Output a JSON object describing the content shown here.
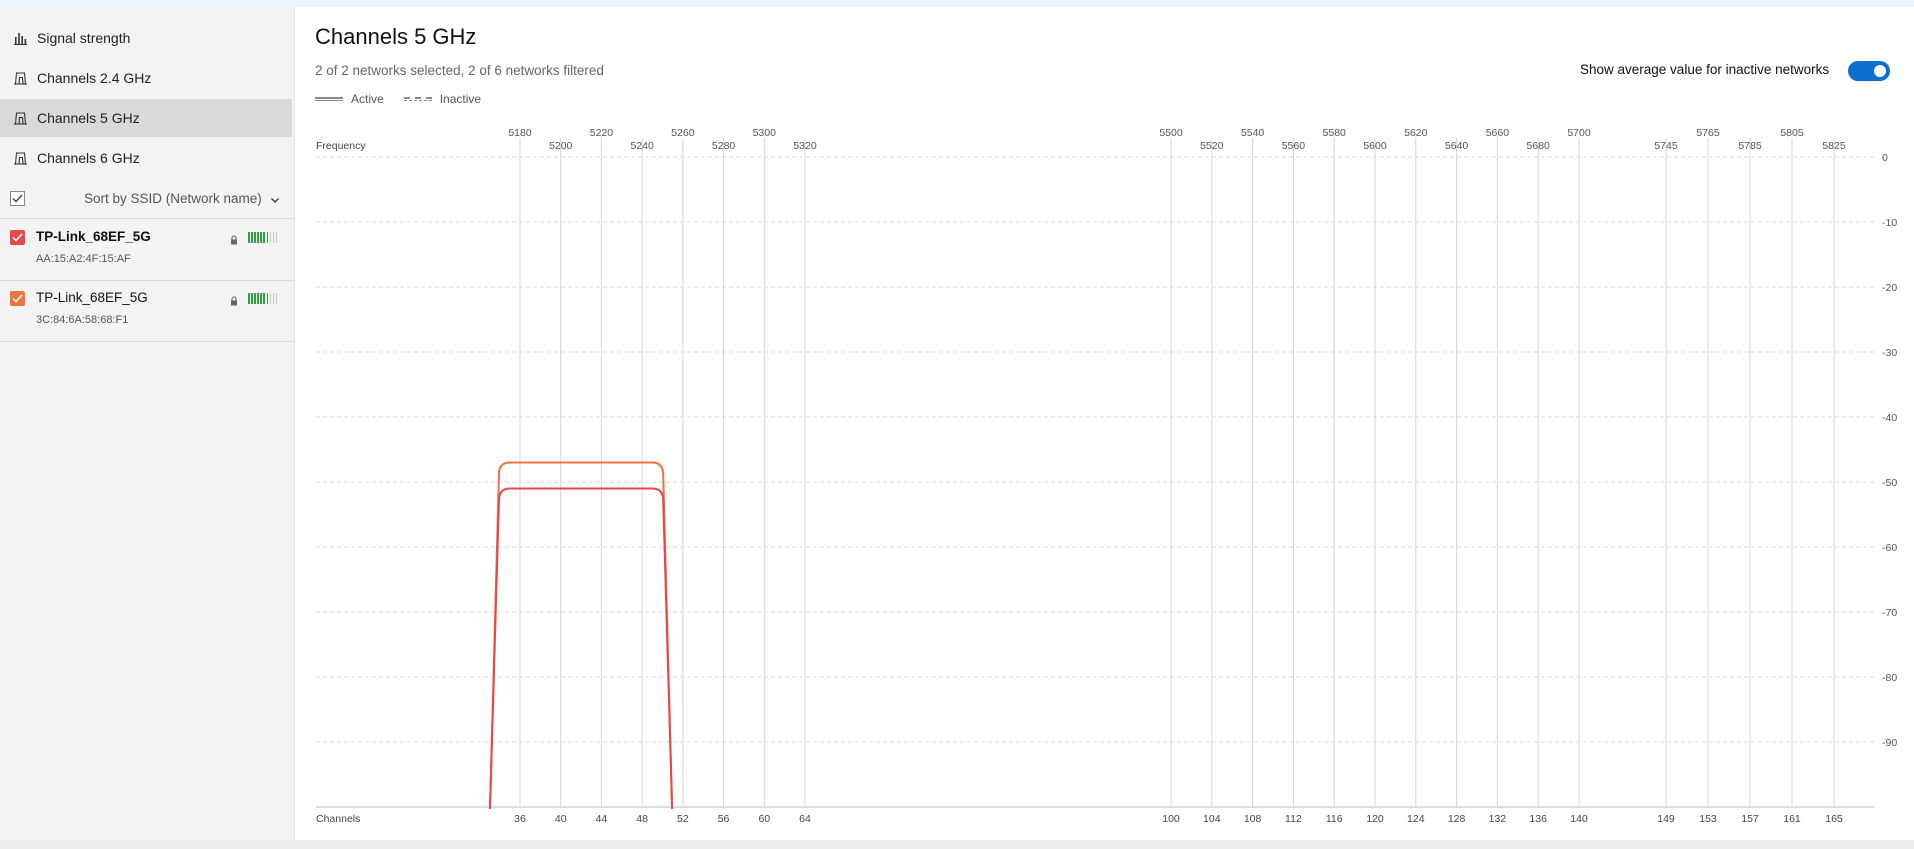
{
  "sidebar": {
    "nav": [
      {
        "label": "Signal strength",
        "icon": "bar-chart-icon"
      },
      {
        "label": "Channels 2.4 GHz",
        "icon": "channel-icon"
      },
      {
        "label": "Channels 5 GHz",
        "icon": "channel-icon",
        "selected": true
      },
      {
        "label": "Channels 6 GHz",
        "icon": "channel-icon"
      }
    ],
    "sort_label": "Sort by SSID (Network name)",
    "networks": [
      {
        "ssid": "TP-Link_68EF_5G",
        "mac": "AA:15:A2:4F:15:AF",
        "color": "#e8474a",
        "bold": true,
        "signal_bars": 7,
        "signal_total": 10
      },
      {
        "ssid": "TP-Link_68EF_5G",
        "mac": "3C:84:6A:58:68:F1",
        "color": "#f07240",
        "bold": false,
        "signal_bars": 7,
        "signal_total": 10
      }
    ]
  },
  "main": {
    "title": "Channels 5 GHz",
    "subtitle": "2 of 2 networks selected, 2 of 6 networks filtered",
    "legend": {
      "active": "Active",
      "inactive": "Inactive"
    },
    "toggle_label": "Show average value for inactive networks",
    "toggle_on": true,
    "accent": "#0a6fce"
  },
  "chart_data": {
    "type": "line",
    "freq_axis_label": "Frequency",
    "channel_axis_label": "Channels",
    "channels": [
      36,
      40,
      44,
      48,
      52,
      56,
      60,
      64,
      100,
      104,
      108,
      112,
      116,
      120,
      124,
      128,
      132,
      136,
      140,
      149,
      153,
      157,
      161,
      165
    ],
    "frequencies": [
      5180,
      5200,
      5220,
      5240,
      5260,
      5280,
      5300,
      5320,
      5500,
      5520,
      5540,
      5560,
      5580,
      5600,
      5620,
      5640,
      5660,
      5680,
      5700,
      5745,
      5765,
      5785,
      5805,
      5825
    ],
    "yticks": [
      0,
      -10,
      -20,
      -30,
      -40,
      -50,
      -60,
      -70,
      -80,
      -90
    ],
    "ylim": [
      -100,
      0
    ],
    "series": [
      {
        "color": "#f07240",
        "channel_start": 36,
        "channel_end": 48,
        "signal_dbm": -47
      },
      {
        "color": "#e8474a",
        "channel_start": 36,
        "channel_end": 48,
        "signal_dbm": -51
      }
    ]
  }
}
